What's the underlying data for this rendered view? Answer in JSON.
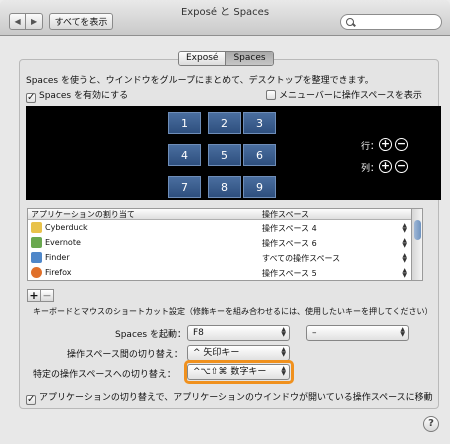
{
  "window": {
    "title": "Exposé と Spaces"
  },
  "toolbar": {
    "back": "◀",
    "forward": "▶",
    "show_all": "すべてを表示",
    "search_placeholder": ""
  },
  "tabs": [
    {
      "label": "Exposé",
      "selected": false
    },
    {
      "label": "Spaces",
      "selected": true
    }
  ],
  "main": {
    "description": "Spaces を使うと、ウインドウをグループにまとめて、デスクトップを整理できます。",
    "enable_label": "Spaces を有効にする",
    "enable_checked": true,
    "menubar_label": "メニューバーに操作スペースを表示",
    "menubar_checked": false
  },
  "grid": {
    "spaces": [
      "1",
      "2",
      "3",
      "4",
      "5",
      "6",
      "7",
      "8",
      "9"
    ],
    "rows_label": "行：",
    "cols_label": "列：",
    "plus": "+",
    "minus": "−"
  },
  "bindings": {
    "col_app": "アプリケーションの割り当て",
    "col_space": "操作スペース",
    "rows": [
      {
        "app": "Cyberduck",
        "space": "操作スペース 4"
      },
      {
        "app": "Evernote",
        "space": "操作スペース 6"
      },
      {
        "app": "Finder",
        "space": "すべての操作スペース"
      },
      {
        "app": "Firefox",
        "space": "操作スペース 5"
      }
    ],
    "add": "+",
    "remove": "−"
  },
  "shortcuts": {
    "header": "キーボードとマウスのショートカット設定（修飾キーを組み合わせるには、使用したいキーを押してください）",
    "activate_label": "Spaces を起動：",
    "activate_value": "F8",
    "activate_mouse_value": "–",
    "switch_label": "操作スペース間の切り替え：",
    "switch_value": "^ 矢印キー",
    "direct_label": "特定の操作スペースへの切り替え：",
    "direct_value": "^⌥⇧⌘ 数字キー"
  },
  "footer": {
    "switch_apps_label": "アプリケーションの切り替えで、アプリケーションのウインドウが開いている操作スペースに移動",
    "switch_apps_checked": true,
    "help": "?"
  },
  "icon_colors": {
    "cyberduck": "#e8c24a",
    "evernote": "#6aa84f",
    "finder": "#4f87c9",
    "firefox": "#e0702a"
  },
  "accent": "#f0911e"
}
